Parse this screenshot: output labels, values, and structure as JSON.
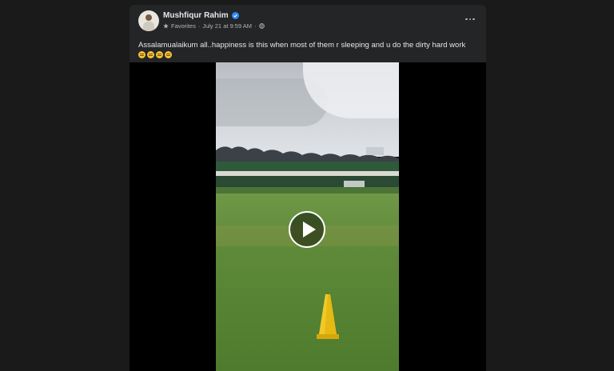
{
  "post": {
    "author": "Mushfiqur Rahim",
    "audience": "Favorites",
    "timestamp": "July 21 at 9:59 AM",
    "separator": "·",
    "caption": "Assalamualaikum all..happiness is this when most of them r sleeping and u do the dirty hard work",
    "emoji_count": 4,
    "verified_color": "#2d88ff"
  },
  "icons": {
    "avatar": "profile-photo",
    "verified": "verified-badge-icon",
    "favorites": "star-icon",
    "privacy": "globe-icon",
    "more": "more-options-icon",
    "play": "play-icon"
  }
}
